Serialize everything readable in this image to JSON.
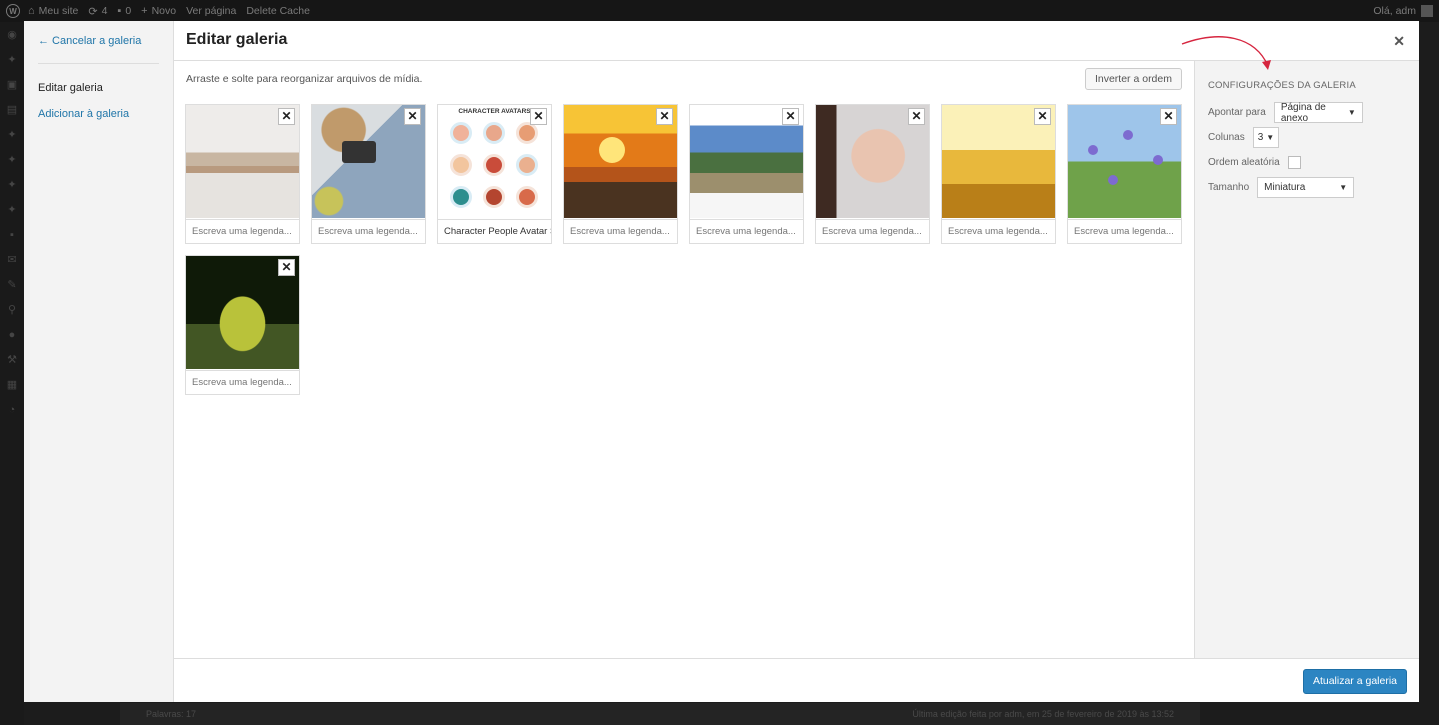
{
  "admin_bar": {
    "site_name": "Meu site",
    "updates_count": "4",
    "comments_count": "0",
    "new_label": "Novo",
    "view_page_label": "Ver página",
    "delete_cache_label": "Delete Cache",
    "greeting": "Olá, adm"
  },
  "background_footer": {
    "word_count": "Palavras: 17",
    "last_edit": "Última edição feita por adm, em 25 de fevereiro de 2019 às 13:52"
  },
  "modal": {
    "cancel_link": "← Cancelar a galeria",
    "menu_items": [
      "Editar galeria",
      "Adicionar à galeria"
    ],
    "title": "Editar galeria",
    "close_icon": "close-icon",
    "instructions": "Arraste e solte para reorganizar arquivos de mídia.",
    "reverse_button": "Inverter a ordem",
    "caption_placeholder": "Escreva uma legenda...",
    "items": [
      {
        "image": "beige-landscape",
        "caption": ""
      },
      {
        "image": "flatlay-camera",
        "caption": ""
      },
      {
        "image": "character-avatars",
        "caption": "Character People Avatar Set",
        "image_text": "CHARACTER AVATARS"
      },
      {
        "image": "sunset-lake",
        "caption": ""
      },
      {
        "image": "mountain-ruins",
        "caption": ""
      },
      {
        "image": "woman-portrait",
        "caption": ""
      },
      {
        "image": "wheat-field",
        "caption": ""
      },
      {
        "image": "wildflowers",
        "caption": ""
      },
      {
        "image": "frog",
        "caption": ""
      }
    ],
    "remove_icon": "remove-x-icon",
    "update_button": "Atualizar a galeria"
  },
  "settings": {
    "heading": "Configurações da galeria",
    "link_to_label": "Apontar para",
    "link_to_value": "Página de anexo",
    "columns_label": "Colunas",
    "columns_value": "3",
    "random_order_label": "Ordem aleatória",
    "random_order_checked": false,
    "size_label": "Tamanho",
    "size_value": "Miniatura"
  },
  "colors": {
    "accent": "#2c85c2",
    "link": "#1f75a8",
    "annotation_arrow": "#d6253f"
  }
}
